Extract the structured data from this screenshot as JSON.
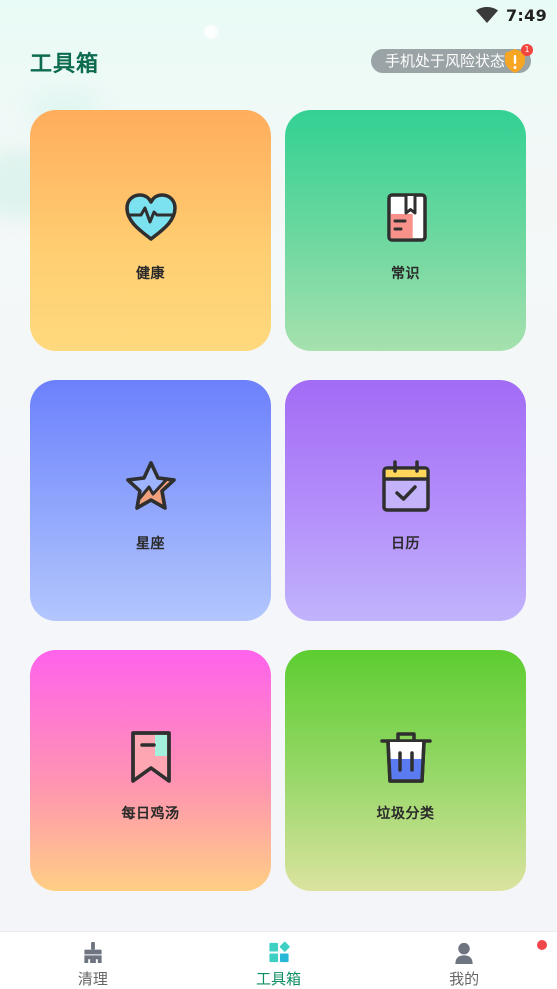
{
  "status_bar": {
    "time": "7:49",
    "wifi_icon": "wifi-icon"
  },
  "header": {
    "title": "工具箱",
    "risk_text": "手机处于风险状态",
    "risk_badge": "1",
    "shield_icon": "shield-warning-icon"
  },
  "tools": [
    {
      "label": "健康",
      "icon": "heart-pulse-icon"
    },
    {
      "label": "常识",
      "icon": "book-icon"
    },
    {
      "label": "星座",
      "icon": "star-icon"
    },
    {
      "label": "日历",
      "icon": "calendar-check-icon"
    },
    {
      "label": "每日鸡汤",
      "icon": "bookmark-icon"
    },
    {
      "label": "垃圾分类",
      "icon": "trash-bin-icon"
    }
  ],
  "nav": [
    {
      "label": "清理",
      "icon": "broom-icon",
      "active": false
    },
    {
      "label": "工具箱",
      "icon": "toolbox-icon",
      "active": true
    },
    {
      "label": "我的",
      "icon": "user-icon",
      "active": false
    }
  ],
  "colors": {
    "title": "#0d6b4f",
    "active_tab": "#0e8e63",
    "badge": "#f2453d"
  }
}
